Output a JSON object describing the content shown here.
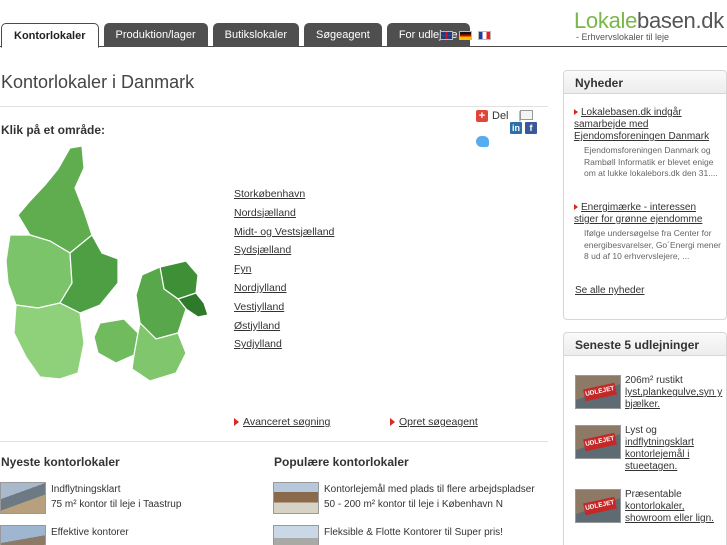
{
  "header": {
    "tabs": [
      {
        "label": "Kontorlokaler",
        "active": true
      },
      {
        "label": "Produktion/lager",
        "active": false
      },
      {
        "label": "Butikslokaler",
        "active": false
      },
      {
        "label": "Søgeagent",
        "active": false
      },
      {
        "label": "For udlejere",
        "active": false
      }
    ],
    "flags": [
      "flag-uk-icon",
      "flag-de-icon",
      "flag-fr-icon"
    ],
    "logo_part1": "Lokale",
    "logo_part2": "basen.dk",
    "tagline": "- Erhvervslokaler til leje"
  },
  "main": {
    "title": "Kontorlokaler i Danmark",
    "share_label": "Del",
    "share_separator": "|",
    "subtitle": "Klik på et område:",
    "regions": [
      "Storkøbenhavn",
      "Nordsjælland",
      "Midt- og Vestsjælland",
      "Sydsjælland",
      "Fyn",
      "Nordjylland",
      "Vestjylland",
      "Østjylland",
      "Sydjylland"
    ],
    "advanced_search": "Avanceret søgning",
    "create_agent": "Opret søgeagent",
    "newest_title": "Nyeste kontorlokaler",
    "popular_title": "Populære kontorlokaler",
    "newest": [
      {
        "line1": "Indflytningsklart",
        "line2": "75 m² kontor til leje i Taastrup"
      },
      {
        "line1": "Effektive kontorer",
        "line2": ""
      }
    ],
    "popular": [
      {
        "line1": "Kontorlejemål med plads til flere arbejdspladser",
        "line2": "50 - 200 m² kontor til leje i København N"
      },
      {
        "line1": "Fleksible & Flotte Kontorer til Super pris!",
        "line2": ""
      }
    ]
  },
  "sidebar": {
    "news_title": "Nyheder",
    "news": [
      {
        "title": "Lokalebasen.dk indgår samarbejde med Ejendomsforeningen Danmark",
        "body": "Ejendomsforeningen Danmark og Rambøll Informatik er blevet enige om at lukke lokalebors.dk den 31...."
      },
      {
        "title": "Energimærke - interessen stiger for grønne ejendomme",
        "body": "Ifølge undersøgelse fra Center for energibesvarelser, Go´Energi mener 8 ud af 10 erhvervslejere, ..."
      }
    ],
    "see_all": "Se alle nyheder",
    "rentals_title": "Seneste 5 udlejninger",
    "rentals": [
      {
        "plain": "206m² rustikt ",
        "link": "lyst,plankegulve,syn y bjælker."
      },
      {
        "plain": "Lyst og ",
        "link": "indflytningsklart kontorlejemål i stueetagen."
      },
      {
        "plain": "Præsentable ",
        "link": "kontorlokaler, showroom eller lign."
      }
    ],
    "stamp": "UDLEJET"
  },
  "colors": {
    "accent_green": "#7ab648",
    "tab_dark": "#4f4f4f",
    "bullet_red": "#d9291c"
  }
}
